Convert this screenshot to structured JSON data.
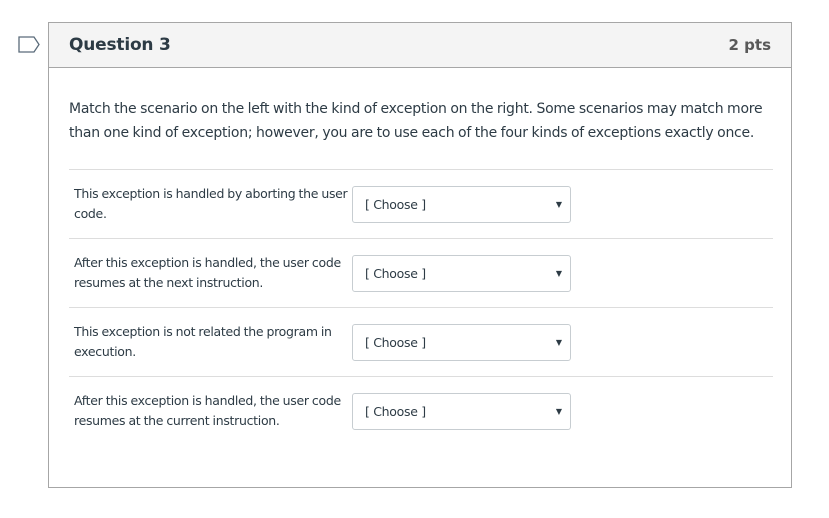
{
  "question": {
    "title": "Question 3",
    "points": "2 pts",
    "flag_icon": "flag-outline-icon",
    "prompt": "Match the scenario on the left with the kind of exception on the right.  Some scenarios may match more than one kind of exception; however, you are to use each of the four kinds of exceptions exactly once.",
    "answers": [
      {
        "label": "This exception is handled by aborting the user code.",
        "selected": "[ Choose ]"
      },
      {
        "label": "After this exception is handled, the user code resumes at the next instruction.",
        "selected": "[ Choose ]"
      },
      {
        "label": "This exception is not related the program in execution.",
        "selected": "[ Choose ]"
      },
      {
        "label": "After this exception is handled, the user code resumes at the current instruction.",
        "selected": "[ Choose ]"
      }
    ],
    "dropdown_arrow": "▼"
  }
}
